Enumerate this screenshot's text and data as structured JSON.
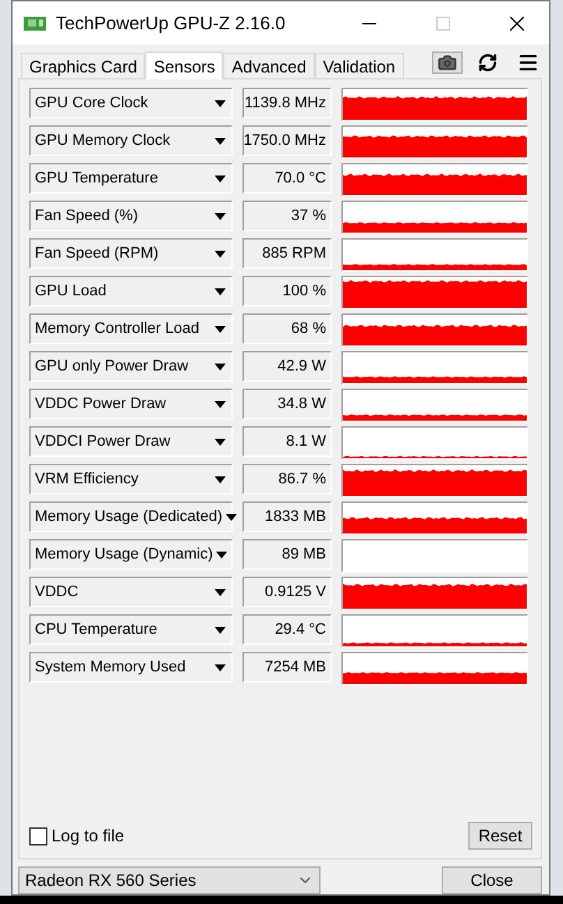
{
  "window": {
    "title": "TechPowerUp GPU-Z 2.16.0",
    "maximize_disabled": true
  },
  "tabs": [
    {
      "label": "Graphics Card",
      "selected": false
    },
    {
      "label": "Sensors",
      "selected": true
    },
    {
      "label": "Advanced",
      "selected": false
    },
    {
      "label": "Validation",
      "selected": false
    }
  ],
  "sensors": [
    {
      "name": "GPU Core Clock",
      "value": "1139.8 MHz"
    },
    {
      "name": "GPU Memory Clock",
      "value": "1750.0 MHz"
    },
    {
      "name": "GPU Temperature",
      "value": "70.0 °C"
    },
    {
      "name": "Fan Speed (%)",
      "value": "37 %"
    },
    {
      "name": "Fan Speed (RPM)",
      "value": "885 RPM"
    },
    {
      "name": "GPU Load",
      "value": "100 %"
    },
    {
      "name": "Memory Controller Load",
      "value": "68 %"
    },
    {
      "name": "GPU only Power Draw",
      "value": "42.9 W"
    },
    {
      "name": "VDDC Power Draw",
      "value": "34.8 W"
    },
    {
      "name": "VDDCI Power Draw",
      "value": "8.1 W"
    },
    {
      "name": "VRM Efficiency",
      "value": "86.7 %"
    },
    {
      "name": "Memory Usage (Dedicated)",
      "value": "1833 MB"
    },
    {
      "name": "Memory Usage (Dynamic)",
      "value": "89 MB"
    },
    {
      "name": "VDDC",
      "value": "0.9125 V"
    },
    {
      "name": "CPU Temperature",
      "value": "29.4 °C"
    },
    {
      "name": "System Memory Used",
      "value": "7254 MB"
    }
  ],
  "log_to_file": {
    "label": "Log to file",
    "checked": false
  },
  "reset_button": "Reset",
  "gpu_select": {
    "value": "Radeon RX 560 Series"
  },
  "close_button": "Close"
}
